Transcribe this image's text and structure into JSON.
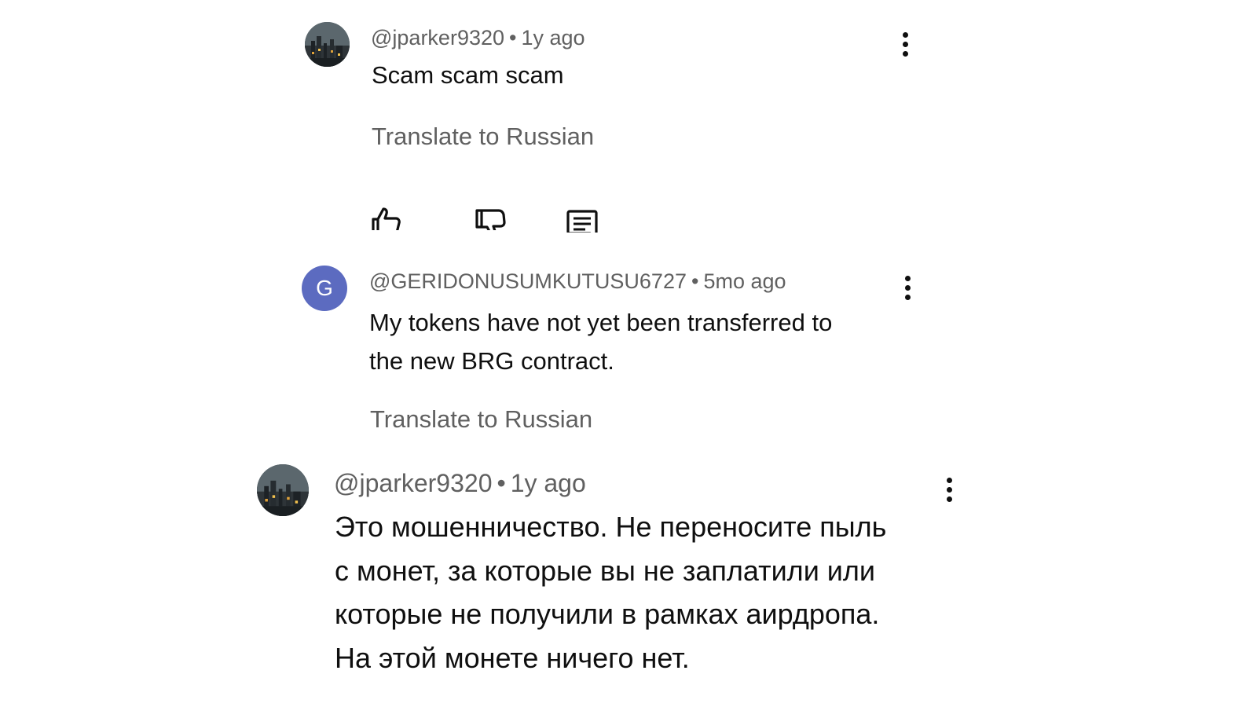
{
  "comments": [
    {
      "author": "@jparker9320",
      "separator": "•",
      "time": "1y ago",
      "text": "Scam scam scam",
      "translate_label": "Translate to Russian",
      "avatar": "photo-avatar",
      "actions": [
        "like-icon",
        "dislike-icon",
        "reply-icon"
      ]
    },
    {
      "author": "@GERIDONUSUMKUTUSU6727",
      "separator": "•",
      "time": "5mo ago",
      "avatar_letter": "G",
      "avatar_color": "#5c6bc0",
      "text_line1": "My tokens have not yet been transferred to",
      "text_line2": "the new BRG contract.",
      "translate_label": "Translate to Russian"
    },
    {
      "author": "@jparker9320",
      "separator": "•",
      "time": "1y ago",
      "avatar": "photo-avatar",
      "text_lines": [
        "Это мошенничество. Не переносите пыль",
        "с монет, за которые вы не заплатили или",
        "которые не получили в рамках аирдропа.",
        "На этой монете ничего нет."
      ]
    }
  ],
  "colors": {
    "text": "#0f0f0f",
    "secondary": "#606060",
    "background": "#ffffff"
  }
}
